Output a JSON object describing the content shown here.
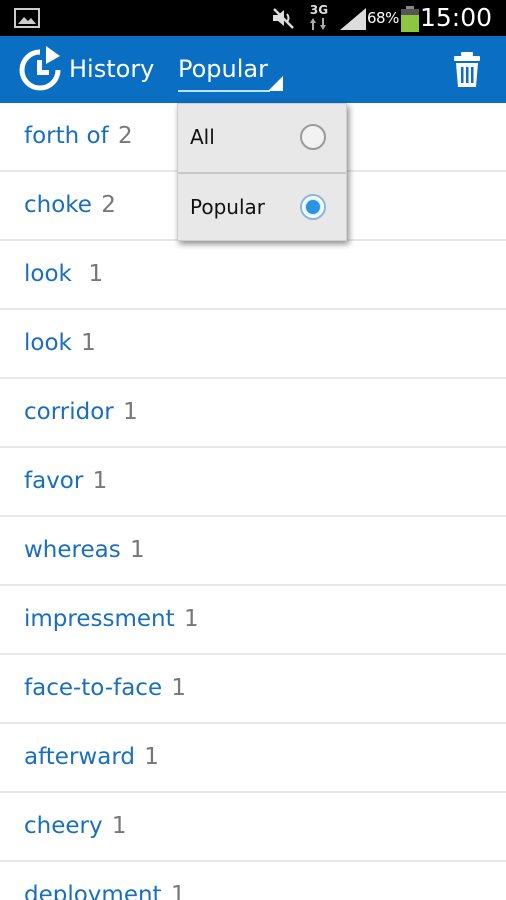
{
  "status_bar": {
    "network_type": "3G",
    "battery_percent": "68%",
    "time": "15:00",
    "icons": [
      "gallery-icon",
      "mute-icon",
      "signal-icon",
      "battery-icon"
    ]
  },
  "action_bar": {
    "title": "History",
    "filter_selected": "Popular",
    "accent_color": "#0a6fc2",
    "icons": [
      "history-icon",
      "trash-icon"
    ]
  },
  "dropdown": {
    "options": [
      {
        "label": "All",
        "selected": false
      },
      {
        "label": "Popular",
        "selected": true
      }
    ]
  },
  "history": {
    "items": [
      {
        "word": "forth of",
        "count": "2"
      },
      {
        "word": "choke",
        "count": "2"
      },
      {
        "word": "look ",
        "count": "1"
      },
      {
        "word": "look",
        "count": "1"
      },
      {
        "word": "corridor",
        "count": "1"
      },
      {
        "word": "favor",
        "count": "1"
      },
      {
        "word": "whereas",
        "count": "1"
      },
      {
        "word": "impressment",
        "count": "1"
      },
      {
        "word": "face-to-face",
        "count": "1"
      },
      {
        "word": "afterward",
        "count": "1"
      },
      {
        "word": "cheery",
        "count": "1"
      },
      {
        "word": "deployment",
        "count": "1"
      }
    ]
  }
}
